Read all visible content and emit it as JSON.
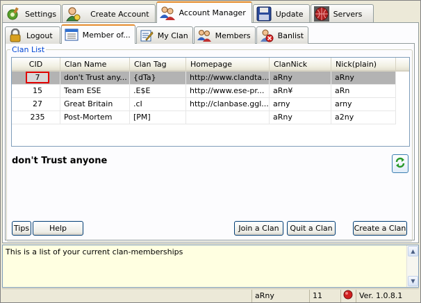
{
  "top_tabs": [
    {
      "label": "Settings",
      "icon": "settings-icon"
    },
    {
      "label": "Create Account",
      "icon": "create-account-icon"
    },
    {
      "label": "Account Manager",
      "icon": "account-manager-icon",
      "active": true
    },
    {
      "label": "Update",
      "icon": "floppy-disk-icon"
    },
    {
      "label": "Servers",
      "icon": "server-globe-icon"
    }
  ],
  "sub_tabs": [
    {
      "label": "Logout",
      "icon": "padlock-icon"
    },
    {
      "label": "Member of...",
      "icon": "list-window-icon",
      "active": true
    },
    {
      "label": "My Clan",
      "icon": "edit-document-icon"
    },
    {
      "label": "Members",
      "icon": "members-icon"
    },
    {
      "label": "Banlist",
      "icon": "banlist-icon"
    }
  ],
  "clan_list": {
    "group_label": "Clan List",
    "columns": [
      "CID",
      "Clan Name",
      "Clan Tag",
      "Homepage",
      "ClanNick",
      "Nick(plain)"
    ],
    "rows": [
      {
        "cid": "7",
        "name": "don't Trust any...",
        "tag": "{dTa}",
        "homepage": "http://www.clandta...",
        "clannick": "aRny",
        "nick_plain": "aRny",
        "selected": true
      },
      {
        "cid": "15",
        "name": "Team ESE",
        "tag": ".E$E",
        "homepage": "http://www.ese-pr...",
        "clannick": "aRn¥",
        "nick_plain": "aRn",
        "selected": false
      },
      {
        "cid": "27",
        "name": "Great Britain",
        "tag": ".cI",
        "homepage": "http://clanbase.ggl....",
        "clannick": "arny",
        "nick_plain": "arny",
        "selected": false
      },
      {
        "cid": "235",
        "name": "Post-Mortem",
        "tag": "[PM]",
        "homepage": "",
        "clannick": "aRny",
        "nick_plain": "a2ny",
        "selected": false
      }
    ]
  },
  "selected_clan_title": "don't Trust anyone",
  "buttons": {
    "tips": "Tips",
    "help": "Help",
    "join": "Join a Clan",
    "quit": "Quit a Clan",
    "create": "Create a Clan"
  },
  "info_text": "This is a list of your current clan-memberships",
  "status": {
    "nick": "aRny",
    "count": "11",
    "version": "Ver. 1.0.8.1"
  },
  "colors": {
    "active_tab_accent": "#e68b2c",
    "selection_marker": "#e00000",
    "info_background": "#ffffe1",
    "status_dot": "#d02020"
  }
}
